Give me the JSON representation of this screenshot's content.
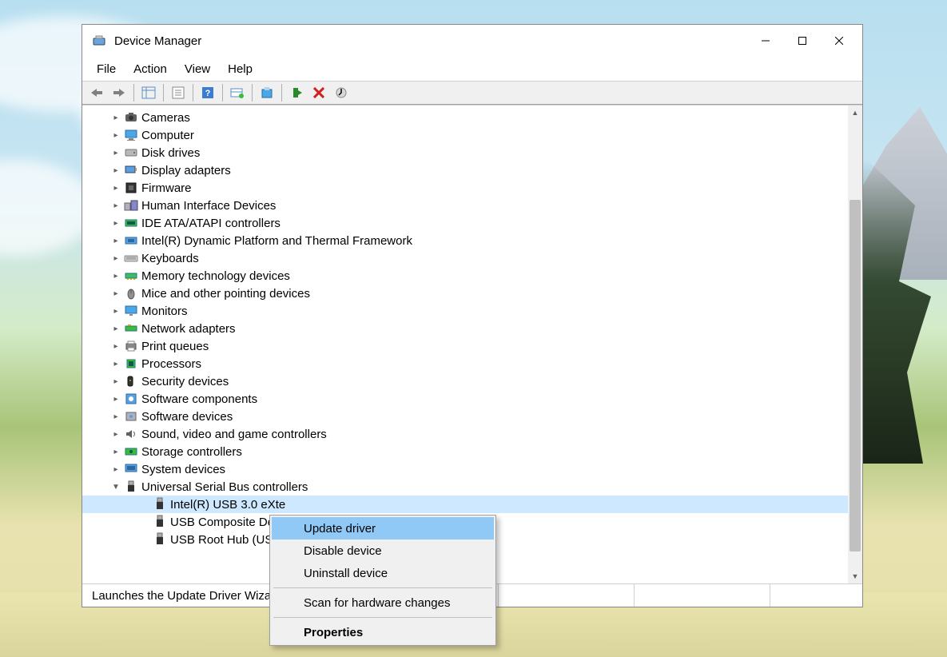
{
  "window": {
    "title": "Device Manager"
  },
  "menu": {
    "file": "File",
    "action": "Action",
    "view": "View",
    "help": "Help"
  },
  "tree": {
    "items": [
      {
        "label": "Cameras",
        "icon": "camera",
        "expanded": false
      },
      {
        "label": "Computer",
        "icon": "computer",
        "expanded": false
      },
      {
        "label": "Disk drives",
        "icon": "disk",
        "expanded": false
      },
      {
        "label": "Display adapters",
        "icon": "display-adapter",
        "expanded": false
      },
      {
        "label": "Firmware",
        "icon": "firmware",
        "expanded": false
      },
      {
        "label": "Human Interface Devices",
        "icon": "hid",
        "expanded": false
      },
      {
        "label": "IDE ATA/ATAPI controllers",
        "icon": "ide",
        "expanded": false
      },
      {
        "label": "Intel(R) Dynamic Platform and Thermal Framework",
        "icon": "intel",
        "expanded": false
      },
      {
        "label": "Keyboards",
        "icon": "keyboard",
        "expanded": false
      },
      {
        "label": "Memory technology devices",
        "icon": "memory",
        "expanded": false
      },
      {
        "label": "Mice and other pointing devices",
        "icon": "mouse",
        "expanded": false
      },
      {
        "label": "Monitors",
        "icon": "monitor",
        "expanded": false
      },
      {
        "label": "Network adapters",
        "icon": "network",
        "expanded": false
      },
      {
        "label": "Print queues",
        "icon": "printer",
        "expanded": false
      },
      {
        "label": "Processors",
        "icon": "cpu",
        "expanded": false
      },
      {
        "label": "Security devices",
        "icon": "security",
        "expanded": false
      },
      {
        "label": "Software components",
        "icon": "software-component",
        "expanded": false
      },
      {
        "label": "Software devices",
        "icon": "software-device",
        "expanded": false
      },
      {
        "label": "Sound, video and game controllers",
        "icon": "sound",
        "expanded": false
      },
      {
        "label": "Storage controllers",
        "icon": "storage",
        "expanded": false
      },
      {
        "label": "System devices",
        "icon": "system",
        "expanded": false
      },
      {
        "label": "Universal Serial Bus controllers",
        "icon": "usb",
        "expanded": true
      }
    ],
    "usb_children": [
      {
        "label": "Intel(R) USB 3.0 eXte",
        "icon": "usb-plug",
        "selected": true
      },
      {
        "label": "USB Composite Dev",
        "icon": "usb-plug",
        "selected": false
      },
      {
        "label": "USB Root Hub (USB",
        "icon": "usb-plug",
        "selected": false
      }
    ]
  },
  "context_menu": {
    "update_driver": "Update driver",
    "disable_device": "Disable device",
    "uninstall_device": "Uninstall device",
    "scan_hardware": "Scan for hardware changes",
    "properties": "Properties"
  },
  "statusbar": {
    "text": "Launches the Update Driver Wizard"
  }
}
